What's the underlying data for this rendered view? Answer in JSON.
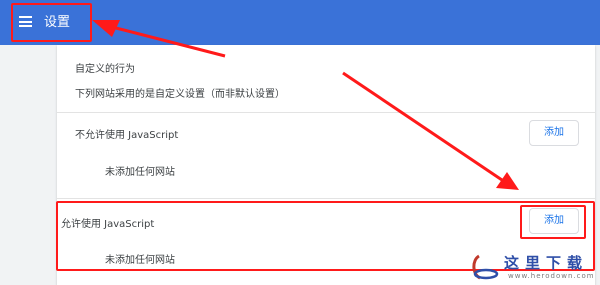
{
  "header": {
    "menu_icon": "hamburger-menu-icon",
    "title": "设置"
  },
  "content": {
    "custom_behavior_heading": "自定义的行为",
    "custom_behavior_desc": "下列网站采用的是自定义设置（而非默认设置）",
    "block_section": {
      "label": "不允许使用 JavaScript",
      "add_label": "添加",
      "empty_text": "未添加任何网站"
    },
    "allow_section": {
      "label": "允许使用 JavaScript",
      "add_label": "添加",
      "empty_text": "未添加任何网站"
    }
  },
  "watermark": {
    "title": "这里下载",
    "url": "www.herodown.com"
  },
  "colors": {
    "header": "#3a72d8",
    "accent": "#1a73e8",
    "annotation": "#ff1a1a"
  }
}
